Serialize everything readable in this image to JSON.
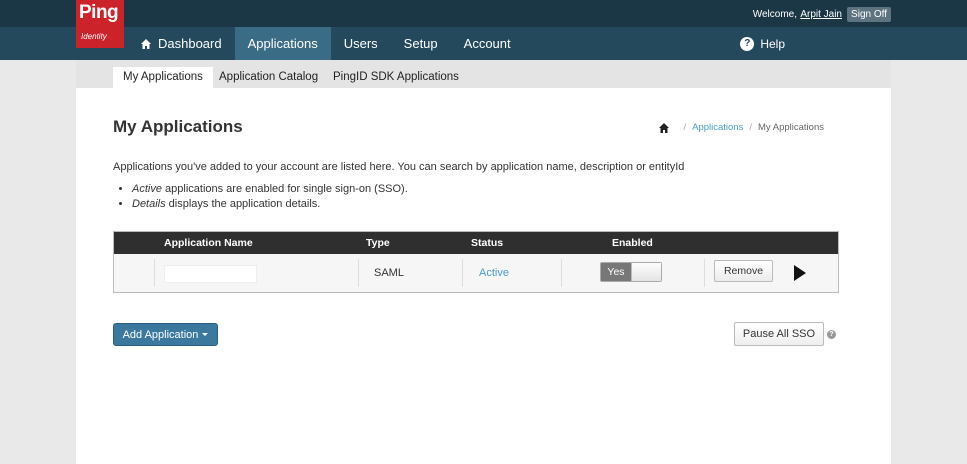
{
  "brand": {
    "name": "Ping",
    "sub": "Identity"
  },
  "utility": {
    "welcome": "Welcome,",
    "user": "Arpit Jain",
    "signoff": "Sign Off"
  },
  "nav": {
    "items": [
      {
        "label": "Dashboard"
      },
      {
        "label": "Applications",
        "active": true
      },
      {
        "label": "Users"
      },
      {
        "label": "Setup"
      },
      {
        "label": "Account"
      }
    ],
    "help": "Help"
  },
  "subnav": {
    "tabs": [
      {
        "label": "My Applications",
        "active": true
      },
      {
        "label": "Application Catalog"
      },
      {
        "label": "PingID SDK Applications"
      }
    ]
  },
  "page": {
    "title": "My Applications",
    "breadcrumb": {
      "link": "Applications",
      "current": "My Applications"
    },
    "intro": "Applications you've added to your account are listed here. You can search by application name, description or entityId",
    "bullets": [
      {
        "em": "Active",
        "text": " applications are enabled for single sign-on (SSO)."
      },
      {
        "em": "Details",
        "text": " displays the application details."
      }
    ]
  },
  "table": {
    "headers": {
      "name": "Application Name",
      "type": "Type",
      "status": "Status",
      "enabled": "Enabled"
    },
    "rows": [
      {
        "name": "",
        "type": "SAML",
        "status": "Active",
        "enabled_label": "Yes",
        "remove": "Remove"
      }
    ]
  },
  "actions": {
    "add": "Add Application",
    "pause": "Pause All SSO",
    "help": "?"
  },
  "colors": {
    "header": "#24495d",
    "nav_active": "#3a6c86",
    "brand": "#cc2229",
    "link": "#4a9bc6",
    "primary_btn": "#3b789e"
  }
}
